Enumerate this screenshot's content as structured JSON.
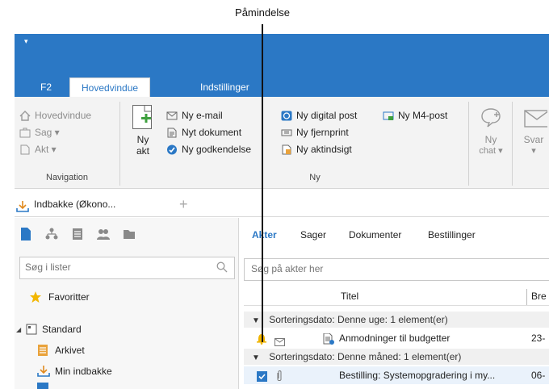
{
  "callout": {
    "label": "Påmindelse"
  },
  "quick_access": "▾",
  "ribbon_tabs": [
    {
      "label": "F2"
    },
    {
      "label": "Hovedvindue"
    },
    {
      "label": "Indstillinger"
    }
  ],
  "navigation": {
    "items": [
      {
        "label": "Hovedvindue"
      },
      {
        "label": "Sag ▾"
      },
      {
        "label": "Akt ▾"
      }
    ],
    "group_label": "Navigation"
  },
  "ny": {
    "ny_akt_line1": "Ny",
    "ny_akt_line2": "akt",
    "col1": [
      {
        "label": "Ny e-mail"
      },
      {
        "label": "Nyt dokument"
      },
      {
        "label": "Ny godkendelse"
      }
    ],
    "col2": [
      {
        "label": "Ny digital post"
      },
      {
        "label": "Ny fjernprint"
      },
      {
        "label": "Ny aktindsigt"
      }
    ],
    "col3": [
      {
        "label": "Ny M4-post"
      }
    ],
    "group_label": "Ny"
  },
  "ny_chat": {
    "line1": "Ny",
    "line2": "chat ▾"
  },
  "svar": {
    "line1": "Svar",
    "line2": "▾"
  },
  "doc_tab": {
    "label": "Indbakke (Økono...",
    "add": "+"
  },
  "left_panel": {
    "search_placeholder": "Søg i lister",
    "favorites": "Favoritter",
    "standard": "Standard",
    "arkivet": "Arkivet",
    "min_indbakke": "Min indbakke",
    "expander": "◢"
  },
  "right_panel": {
    "tabs": [
      {
        "label": "Akter"
      },
      {
        "label": "Sager"
      },
      {
        "label": "Dokumenter"
      },
      {
        "label": "Bestillinger"
      }
    ],
    "search_placeholder": "Søg på akter her",
    "columns": {
      "title": "Titel",
      "date": "Bre"
    },
    "groups": [
      {
        "label": "Sorteringsdato: Denne uge: 1 element(er)"
      },
      {
        "label": "Sorteringsdato: Denne måned: 1 element(er)"
      }
    ],
    "rows": [
      {
        "title": "Anmodninger til budgetter",
        "date": "23-"
      },
      {
        "title": "Bestilling: Systemopgradering i my...",
        "date": "06-"
      }
    ],
    "group_toggle": "▼"
  },
  "colors": {
    "accent": "#2b78c5",
    "bell": "#f0b400",
    "star": "#f2b600"
  }
}
